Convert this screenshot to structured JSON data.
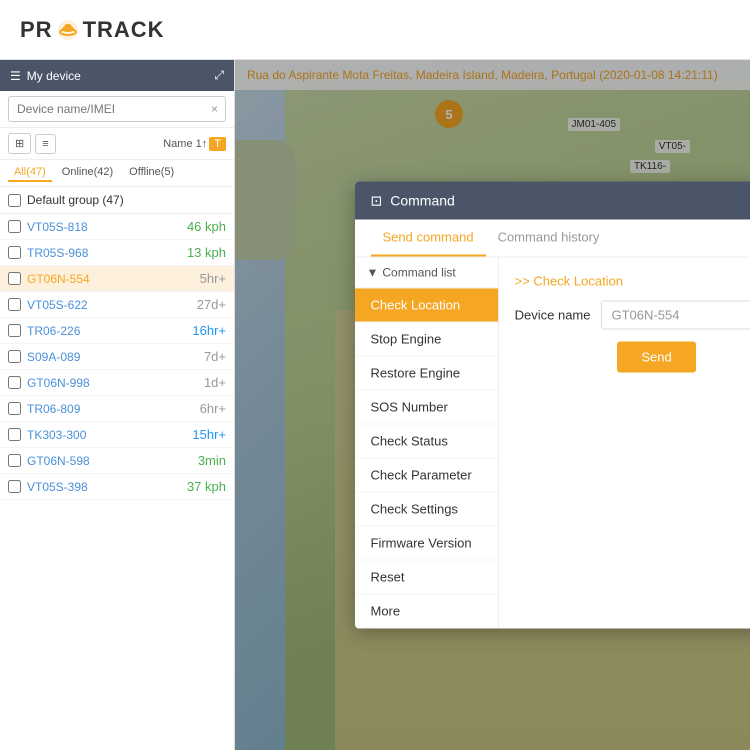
{
  "app": {
    "title": "PROTRACK",
    "logo_icon": "🔁"
  },
  "header": {
    "address": "Rua do Aspirante Mota Freitas, Madeira Island, Madeira, Portugal",
    "timestamp": "(2020-01-08 14:21:11)"
  },
  "sidebar": {
    "title": "My device",
    "search_placeholder": "Device name/IMEI",
    "toolbar": {
      "icon_btn": "⊞",
      "list_btn": "≡",
      "name_label": "Name 1↑",
      "t_label": "T"
    },
    "tabs": [
      {
        "label": "All(47)"
      },
      {
        "label": "Online(42)"
      },
      {
        "label": "Offline(5)"
      }
    ],
    "device_group": "Default group (47)",
    "devices": [
      {
        "name": "VT05S-818",
        "status": "46 kph",
        "status_class": "status-green"
      },
      {
        "name": "TR05S-968",
        "status": "13 kph",
        "status_class": "status-green"
      },
      {
        "name": "GT06N-554",
        "status": "5hr+",
        "status_class": "status-gray",
        "selected": true
      },
      {
        "name": "VT05S-622",
        "status": "27d+",
        "status_class": "status-gray"
      },
      {
        "name": "TR06-226",
        "status": "16hr+",
        "status_class": "status-blue"
      },
      {
        "name": "S09A-089",
        "status": "7d+",
        "status_class": "status-gray"
      },
      {
        "name": "GT06N-998",
        "status": "1d+",
        "status_class": "status-gray"
      },
      {
        "name": "TR06-809",
        "status": "6hr+",
        "status_class": "status-gray"
      },
      {
        "name": "TK303-300",
        "status": "15hr+",
        "status_class": "status-blue"
      },
      {
        "name": "GT06N-598",
        "status": "3min",
        "status_class": "status-green"
      },
      {
        "name": "VT05S-398",
        "status": "37 kph",
        "status_class": "status-green"
      }
    ]
  },
  "map": {
    "cluster_count": "5",
    "labels": [
      "JM01-405",
      "VT05-",
      "TK116-"
    ]
  },
  "modal": {
    "title": "Command",
    "close_label": "×",
    "tabs": [
      {
        "label": "Send command",
        "active": true
      },
      {
        "label": "Command history",
        "active": false
      }
    ],
    "cmd_list_header": "Command list",
    "selected_cmd_label": ">> Check Location",
    "commands": [
      {
        "label": "Check Location",
        "active": true
      },
      {
        "label": "Stop Engine",
        "active": false
      },
      {
        "label": "Restore Engine",
        "active": false
      },
      {
        "label": "SOS Number",
        "active": false
      },
      {
        "label": "Check Status",
        "active": false
      },
      {
        "label": "Check Parameter",
        "active": false
      },
      {
        "label": "Check Settings",
        "active": false
      },
      {
        "label": "Firmware Version",
        "active": false
      },
      {
        "label": "Reset",
        "active": false
      },
      {
        "label": "More",
        "active": false
      }
    ],
    "device_name_label": "Device name",
    "device_name_value": "GT06N-554",
    "send_button": "Send"
  }
}
